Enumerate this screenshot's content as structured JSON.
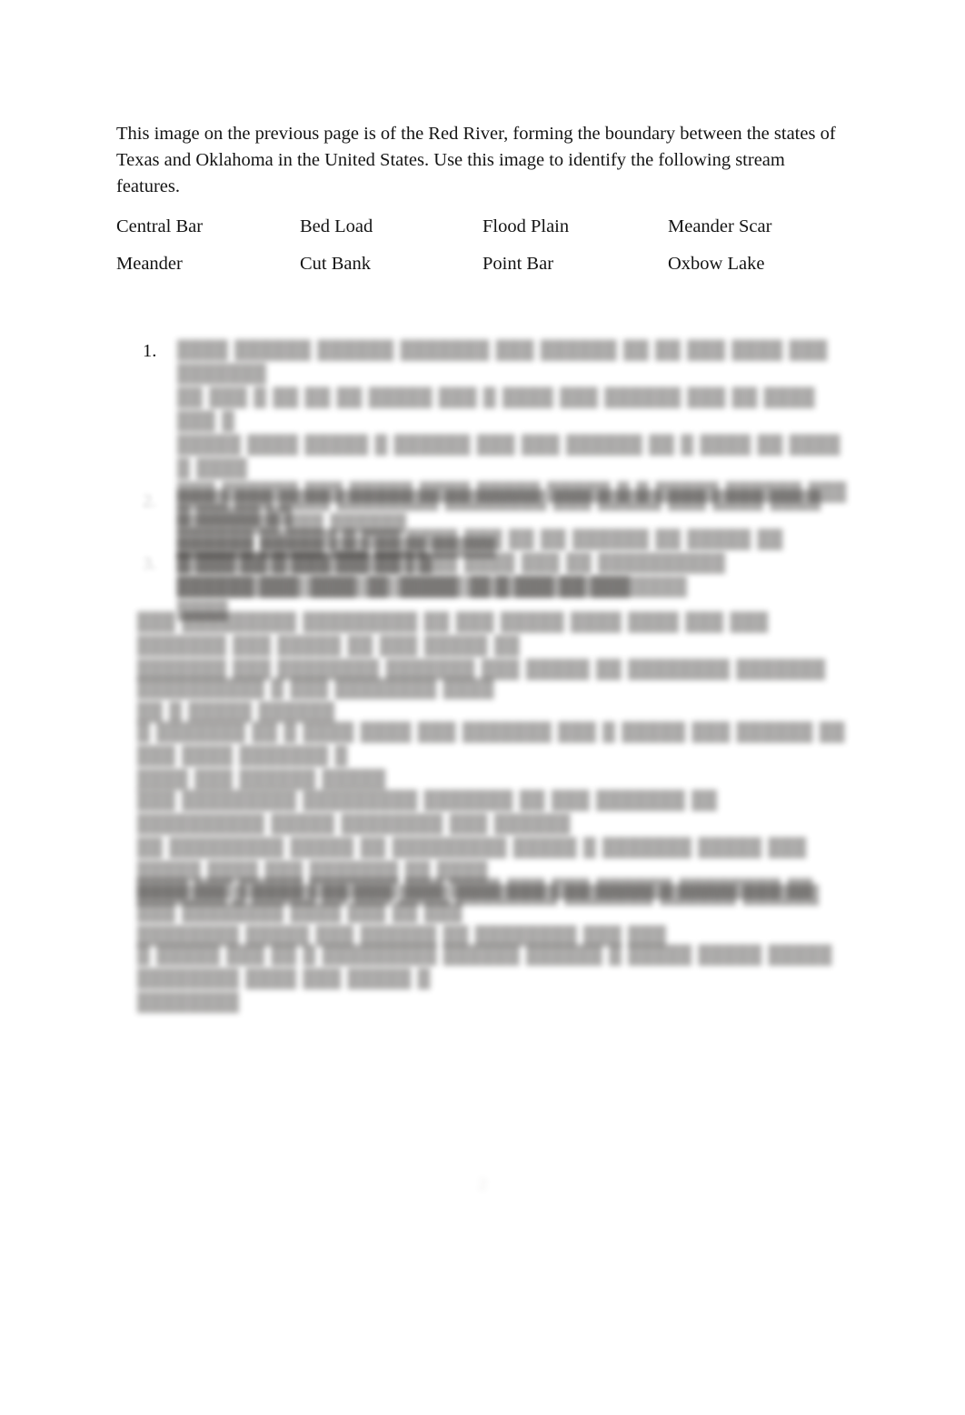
{
  "document": {
    "intro_paragraph": "This image on the previous page is of the Red River, forming the boundary between the states of Texas and Oklahoma in the United States. Use this image to identify the following stream features.",
    "page_number": "2"
  },
  "terms": {
    "rows": [
      [
        {
          "label": "Central Bar"
        },
        {
          "label": "Bed Load"
        },
        {
          "label": "Flood Plain"
        },
        {
          "label": "Meander Scar"
        }
      ],
      [
        {
          "label": "Meander"
        },
        {
          "label": "Cut Bank"
        },
        {
          "label": "Point Bar"
        },
        {
          "label": "Oxbow Lake"
        }
      ]
    ]
  },
  "numbered_list": [
    {
      "marker": "1.",
      "marker_legible": true,
      "legible": false,
      "lines": [
        "████ ██████ ██████ ███████ ███ ██████ ██ ██ ███ ████ ███ ███████",
        "██ ███ █ ██ ██ ██ █████ ███ █ ████ ███ ██████ ███ ██ ████ ███ █",
        "█████ ████ █████ █ ██████ ███ ███ ██████ ██ █ ████ ██ ████ █ ████",
        "███ ██████ ███ █████ ████ █████ █████ █ █ █████ ██████ ███ █ █████ ██",
        "██████ ██████ █ ███ ████ ███ ██ ██ ██████ ██ █████ ██ ███████ █ ███ ██████ █",
        "██████ ███ ████ ██ █████ ██ █ ███ ██████████"
      ]
    },
    {
      "marker": "2.",
      "marker_legible": false,
      "legible": false,
      "lines": [
        "████ ███ ████ ████████ ████████ ███ █████ ███ ████ ████ ████████ ███ ██████",
        "██████ █████ ███ ████ █████"
      ]
    },
    {
      "marker": "3.",
      "marker_legible": false,
      "legible": false,
      "lines": [
        "█ ███ ██████████ ██ ████ ████ ███ ██ ██████████ ██████████ ████ ██ █████ █████████ ███",
        "████"
      ]
    }
  ],
  "paragraphs": [
    {
      "legible": false,
      "lines": [
        "███ █████████ █████████ ██ ███ █████ ████ ████ ███ ███ ███████ ███ █████ ██ ███ █████ ██",
        "███████ ███ ████████ ███████ ███ █████ ██ ████████ ███████"
      ]
    },
    {
      "legible": false,
      "lines": [
        "██████████ █ ███ ████████ ████ ██ █ █████ ██████"
      ]
    },
    {
      "legible": false,
      "lines": [
        "█ ███████ ██ █ ████ ████ ███ ███████ ███ █ █████ ███ ██████ ██ ███ ████ ███████ █",
        "████ ███ ██████ █████"
      ]
    },
    {
      "legible": false,
      "lines": [
        "███ █████████ █████████ ███████ ██ ███ ███████ ██ ██████████ █████ ████████ ███ ██████",
        "██ █████████ █████ ██ █████████ █████ █ ███████ █████ ███ █████ ████ ███ ███████ ██ ████",
        "███████ █ █████ ██ ███ ████ ████████ ███████ ██████ ██████"
      ]
    },
    {
      "legible": false,
      "lines": [
        "████ ███ █████ ███████ ███ ████ ███ ███ ██████ ████████ ██ ███ ████████ ████ ███ ██ ███",
        "████████ █████ ███ ██████ ██ ████████ ███ ███"
      ]
    },
    {
      "legible": false,
      "lines": [
        "█ █████ ███ ██ █ █████████ ██████ ██████ █ █████ █████ █████ ████████ ████ ███ █████ █",
        "████████"
      ]
    }
  ]
}
